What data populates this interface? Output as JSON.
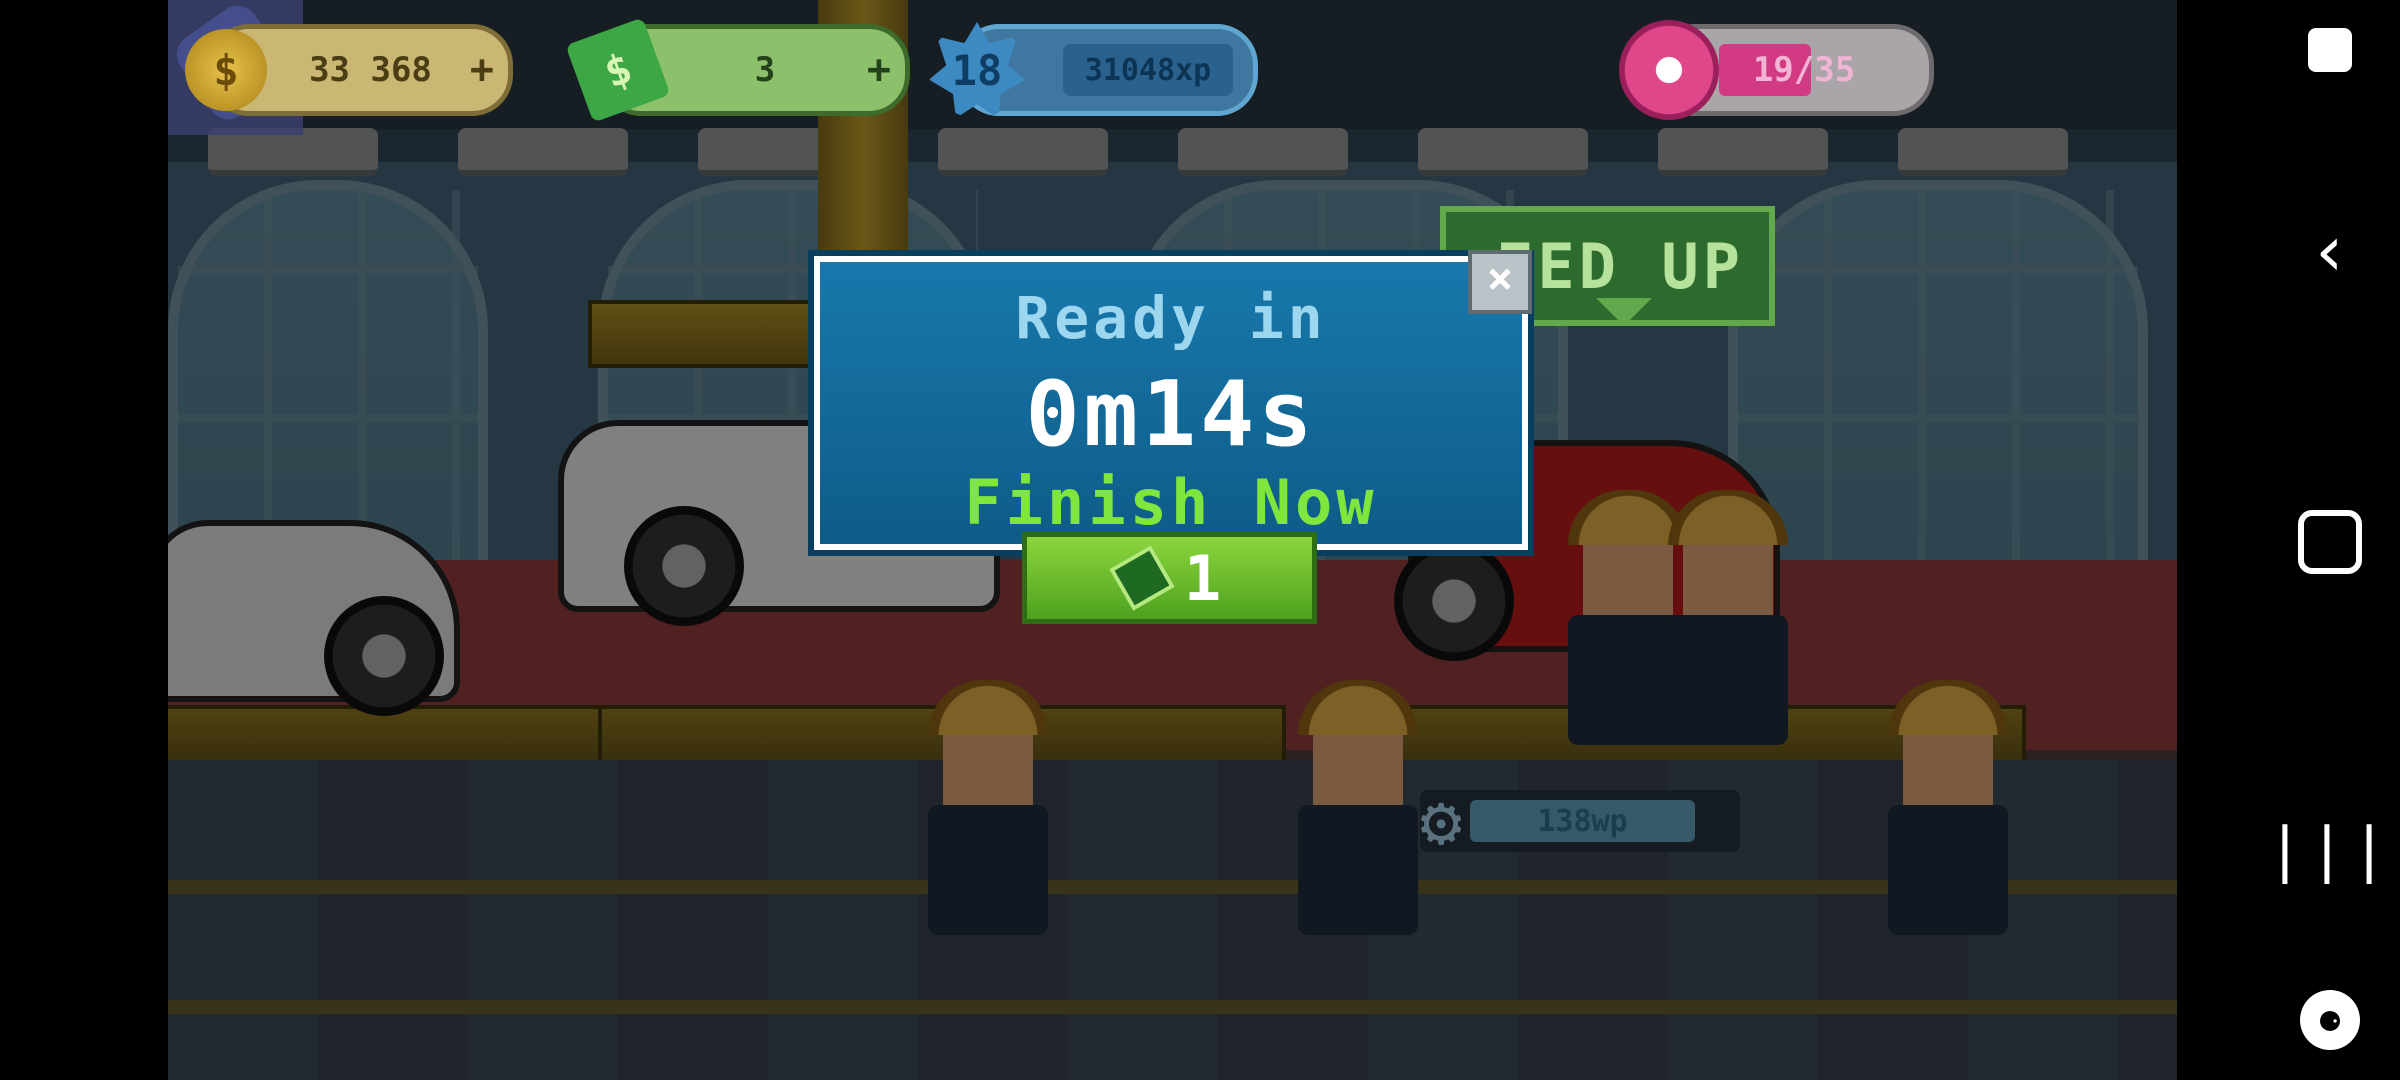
{
  "hud": {
    "coins": "33 368",
    "cash": "3",
    "level": "18",
    "xp": "31048xp",
    "donut": "19/35",
    "donut_fill_fraction": 0.54,
    "plus": "+"
  },
  "sign": {
    "text": "EED UP"
  },
  "dialog": {
    "title": "Ready in",
    "timer": "0m14s",
    "action": "Finish Now",
    "cost": "1",
    "close": "×"
  },
  "workplace": {
    "wp_label": "138wp"
  },
  "colors": {
    "dialog_blue": "#1879ad",
    "finish_green": "#7ee63d",
    "button_green": "#6abf2f"
  },
  "nav": {
    "back": "‹",
    "recent": "|||",
    "game": "⚈"
  }
}
